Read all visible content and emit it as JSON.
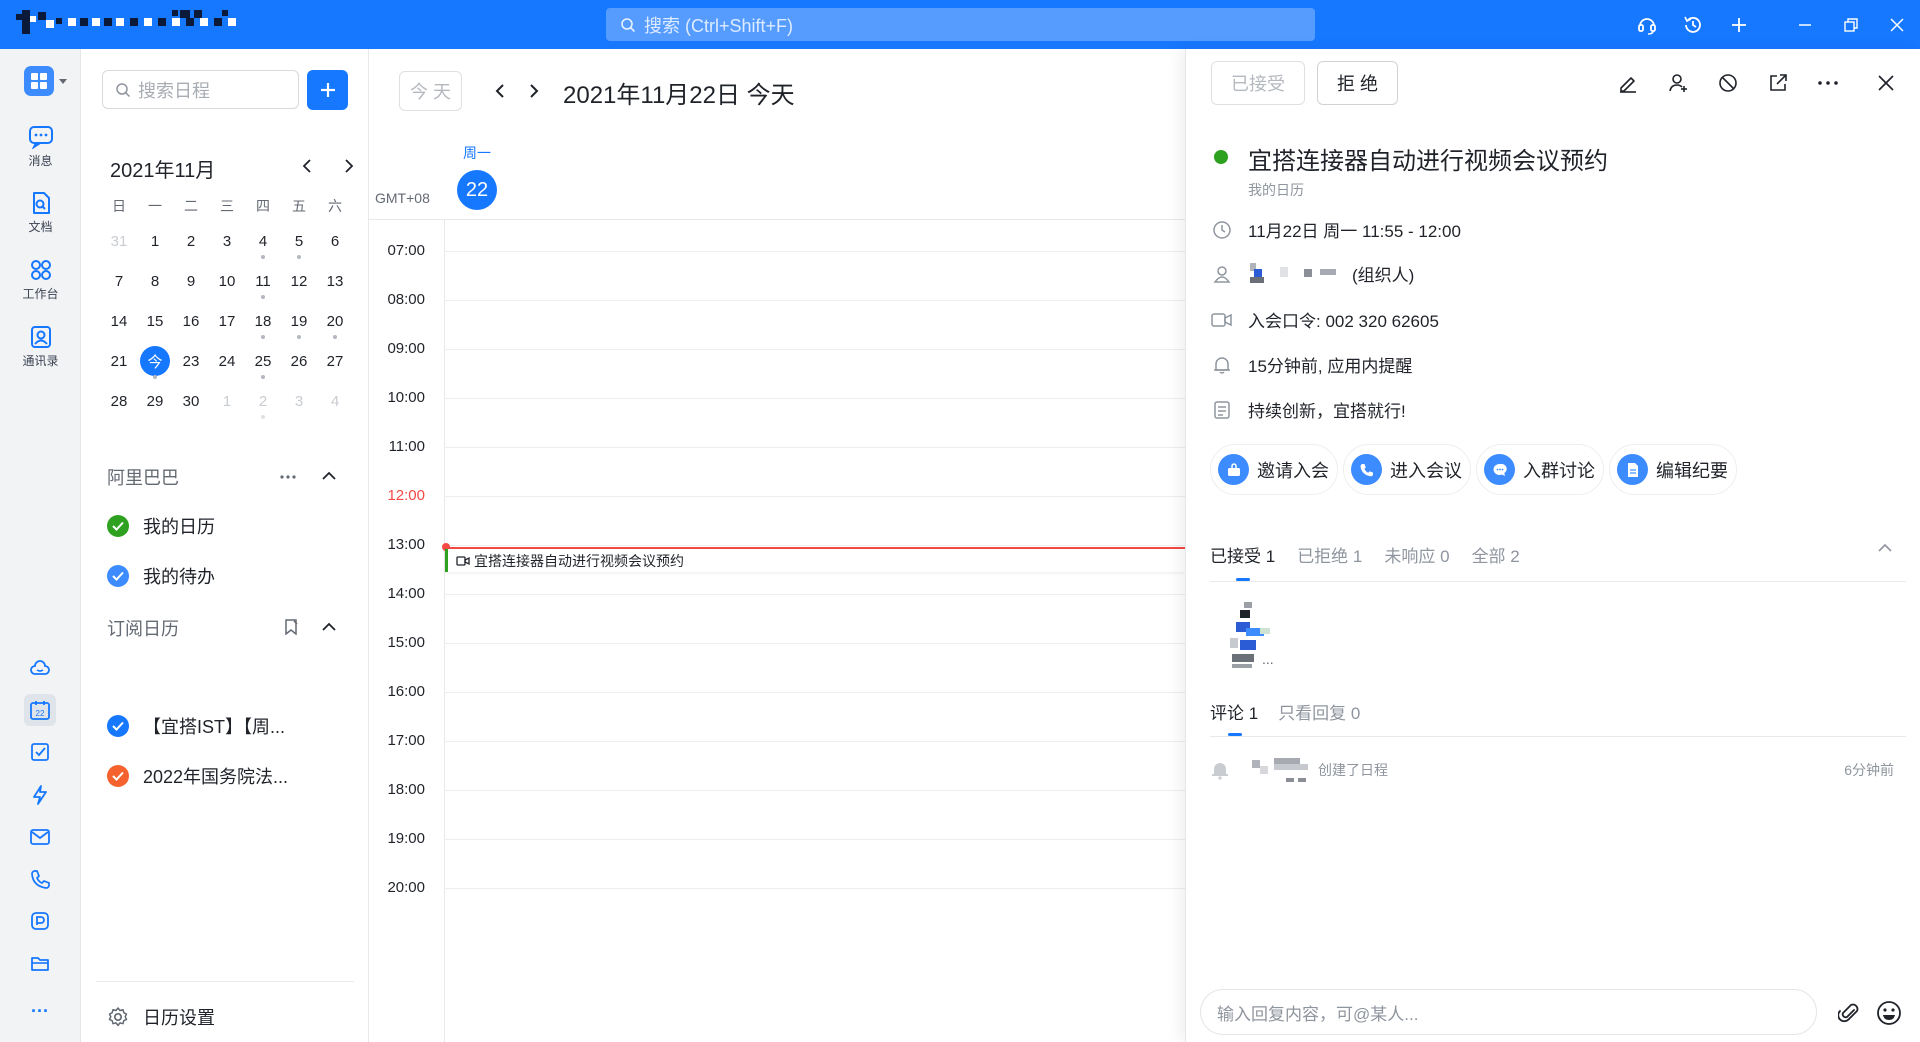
{
  "topbar": {
    "search_placeholder": "搜索 (Ctrl+Shift+F)",
    "accent": "#1677ff"
  },
  "rail": {
    "items": [
      {
        "label": "消息",
        "icon": "chat-icon"
      },
      {
        "label": "文档",
        "icon": "doc-icon"
      },
      {
        "label": "工作台",
        "icon": "workbench-icon"
      },
      {
        "label": "通讯录",
        "icon": "contacts-icon"
      }
    ],
    "more": "···"
  },
  "sidebar": {
    "search_placeholder": "搜索日程",
    "mini_cal": {
      "title": "2021年11月",
      "weekdays": [
        "日",
        "一",
        "二",
        "三",
        "四",
        "五",
        "六"
      ],
      "weeks": [
        [
          {
            "d": "31",
            "o": true
          },
          {
            "d": "1"
          },
          {
            "d": "2"
          },
          {
            "d": "3"
          },
          {
            "d": "4",
            "dot": true
          },
          {
            "d": "5",
            "dot": true
          },
          {
            "d": "6"
          }
        ],
        [
          {
            "d": "7"
          },
          {
            "d": "8"
          },
          {
            "d": "9"
          },
          {
            "d": "10"
          },
          {
            "d": "11",
            "dot": true
          },
          {
            "d": "12"
          },
          {
            "d": "13"
          }
        ],
        [
          {
            "d": "14"
          },
          {
            "d": "15"
          },
          {
            "d": "16"
          },
          {
            "d": "17"
          },
          {
            "d": "18",
            "dot": true
          },
          {
            "d": "19",
            "dot": true
          },
          {
            "d": "20",
            "dot": true
          }
        ],
        [
          {
            "d": "21"
          },
          {
            "d": "今",
            "today": true,
            "dot": true
          },
          {
            "d": "23"
          },
          {
            "d": "24"
          },
          {
            "d": "25",
            "dot": true
          },
          {
            "d": "26"
          },
          {
            "d": "27"
          }
        ],
        [
          {
            "d": "28"
          },
          {
            "d": "29"
          },
          {
            "d": "30"
          },
          {
            "d": "1",
            "o": true
          },
          {
            "d": "2",
            "o": true,
            "dot": true
          },
          {
            "d": "3",
            "o": true
          },
          {
            "d": "4",
            "o": true
          }
        ]
      ]
    },
    "group1": {
      "title": "阿里巴巴",
      "items": [
        {
          "label": "我的日历",
          "color": "#2ea121"
        },
        {
          "label": "我的待办",
          "color": "#3c8cff"
        }
      ]
    },
    "group2": {
      "title": "订阅日历",
      "items": [
        {
          "label": "【宜搭IST】【周...",
          "color": "#1677ff"
        },
        {
          "label": "2022年国务院法...",
          "color": "#f5622d"
        }
      ]
    },
    "settings_label": "日历设置"
  },
  "main": {
    "today_btn": "今 天",
    "date_title": "2021年11月22日 今天",
    "weekday": "周一",
    "day_number": "22",
    "timezone": "GMT+08",
    "hours": [
      "07:00",
      "08:00",
      "09:00",
      "10:00",
      "11:00",
      "12:00",
      "13:00",
      "14:00",
      "15:00",
      "16:00",
      "17:00",
      "18:00",
      "19:00",
      "20:00"
    ],
    "current_hour_color": "#f54a45",
    "event_title": "宜搭连接器自动进行视频会议预约"
  },
  "detail": {
    "accepted_btn": "已接受",
    "decline_btn": "拒 绝",
    "title": "宜搭连接器自动进行视频会议预约",
    "calendar": "我的日历",
    "time": "11月22日 周一 11:55 - 12:00",
    "organizer_suffix": "(组织人)",
    "meeting_code": "入会口令:  002 320 62605",
    "reminder": "15分钟前, 应用内提醒",
    "description": "持续创新，宜搭就行!",
    "actions": [
      {
        "label": "邀请入会",
        "icon": "invite-icon"
      },
      {
        "label": "进入会议",
        "icon": "phone-icon"
      },
      {
        "label": "入群讨论",
        "icon": "group-chat-icon"
      },
      {
        "label": "编辑纪要",
        "icon": "notes-icon"
      }
    ],
    "rsvp_tabs": [
      "已接受 1",
      "已拒绝 1",
      "未响应 0",
      "全部 2"
    ],
    "attendee_more": "...",
    "comment_tabs": [
      "评论 1",
      "只看回复 0"
    ],
    "activity_text": "创建了日程",
    "activity_time": "6分钟前",
    "reply_placeholder": "输入回复内容，可@某人..."
  }
}
